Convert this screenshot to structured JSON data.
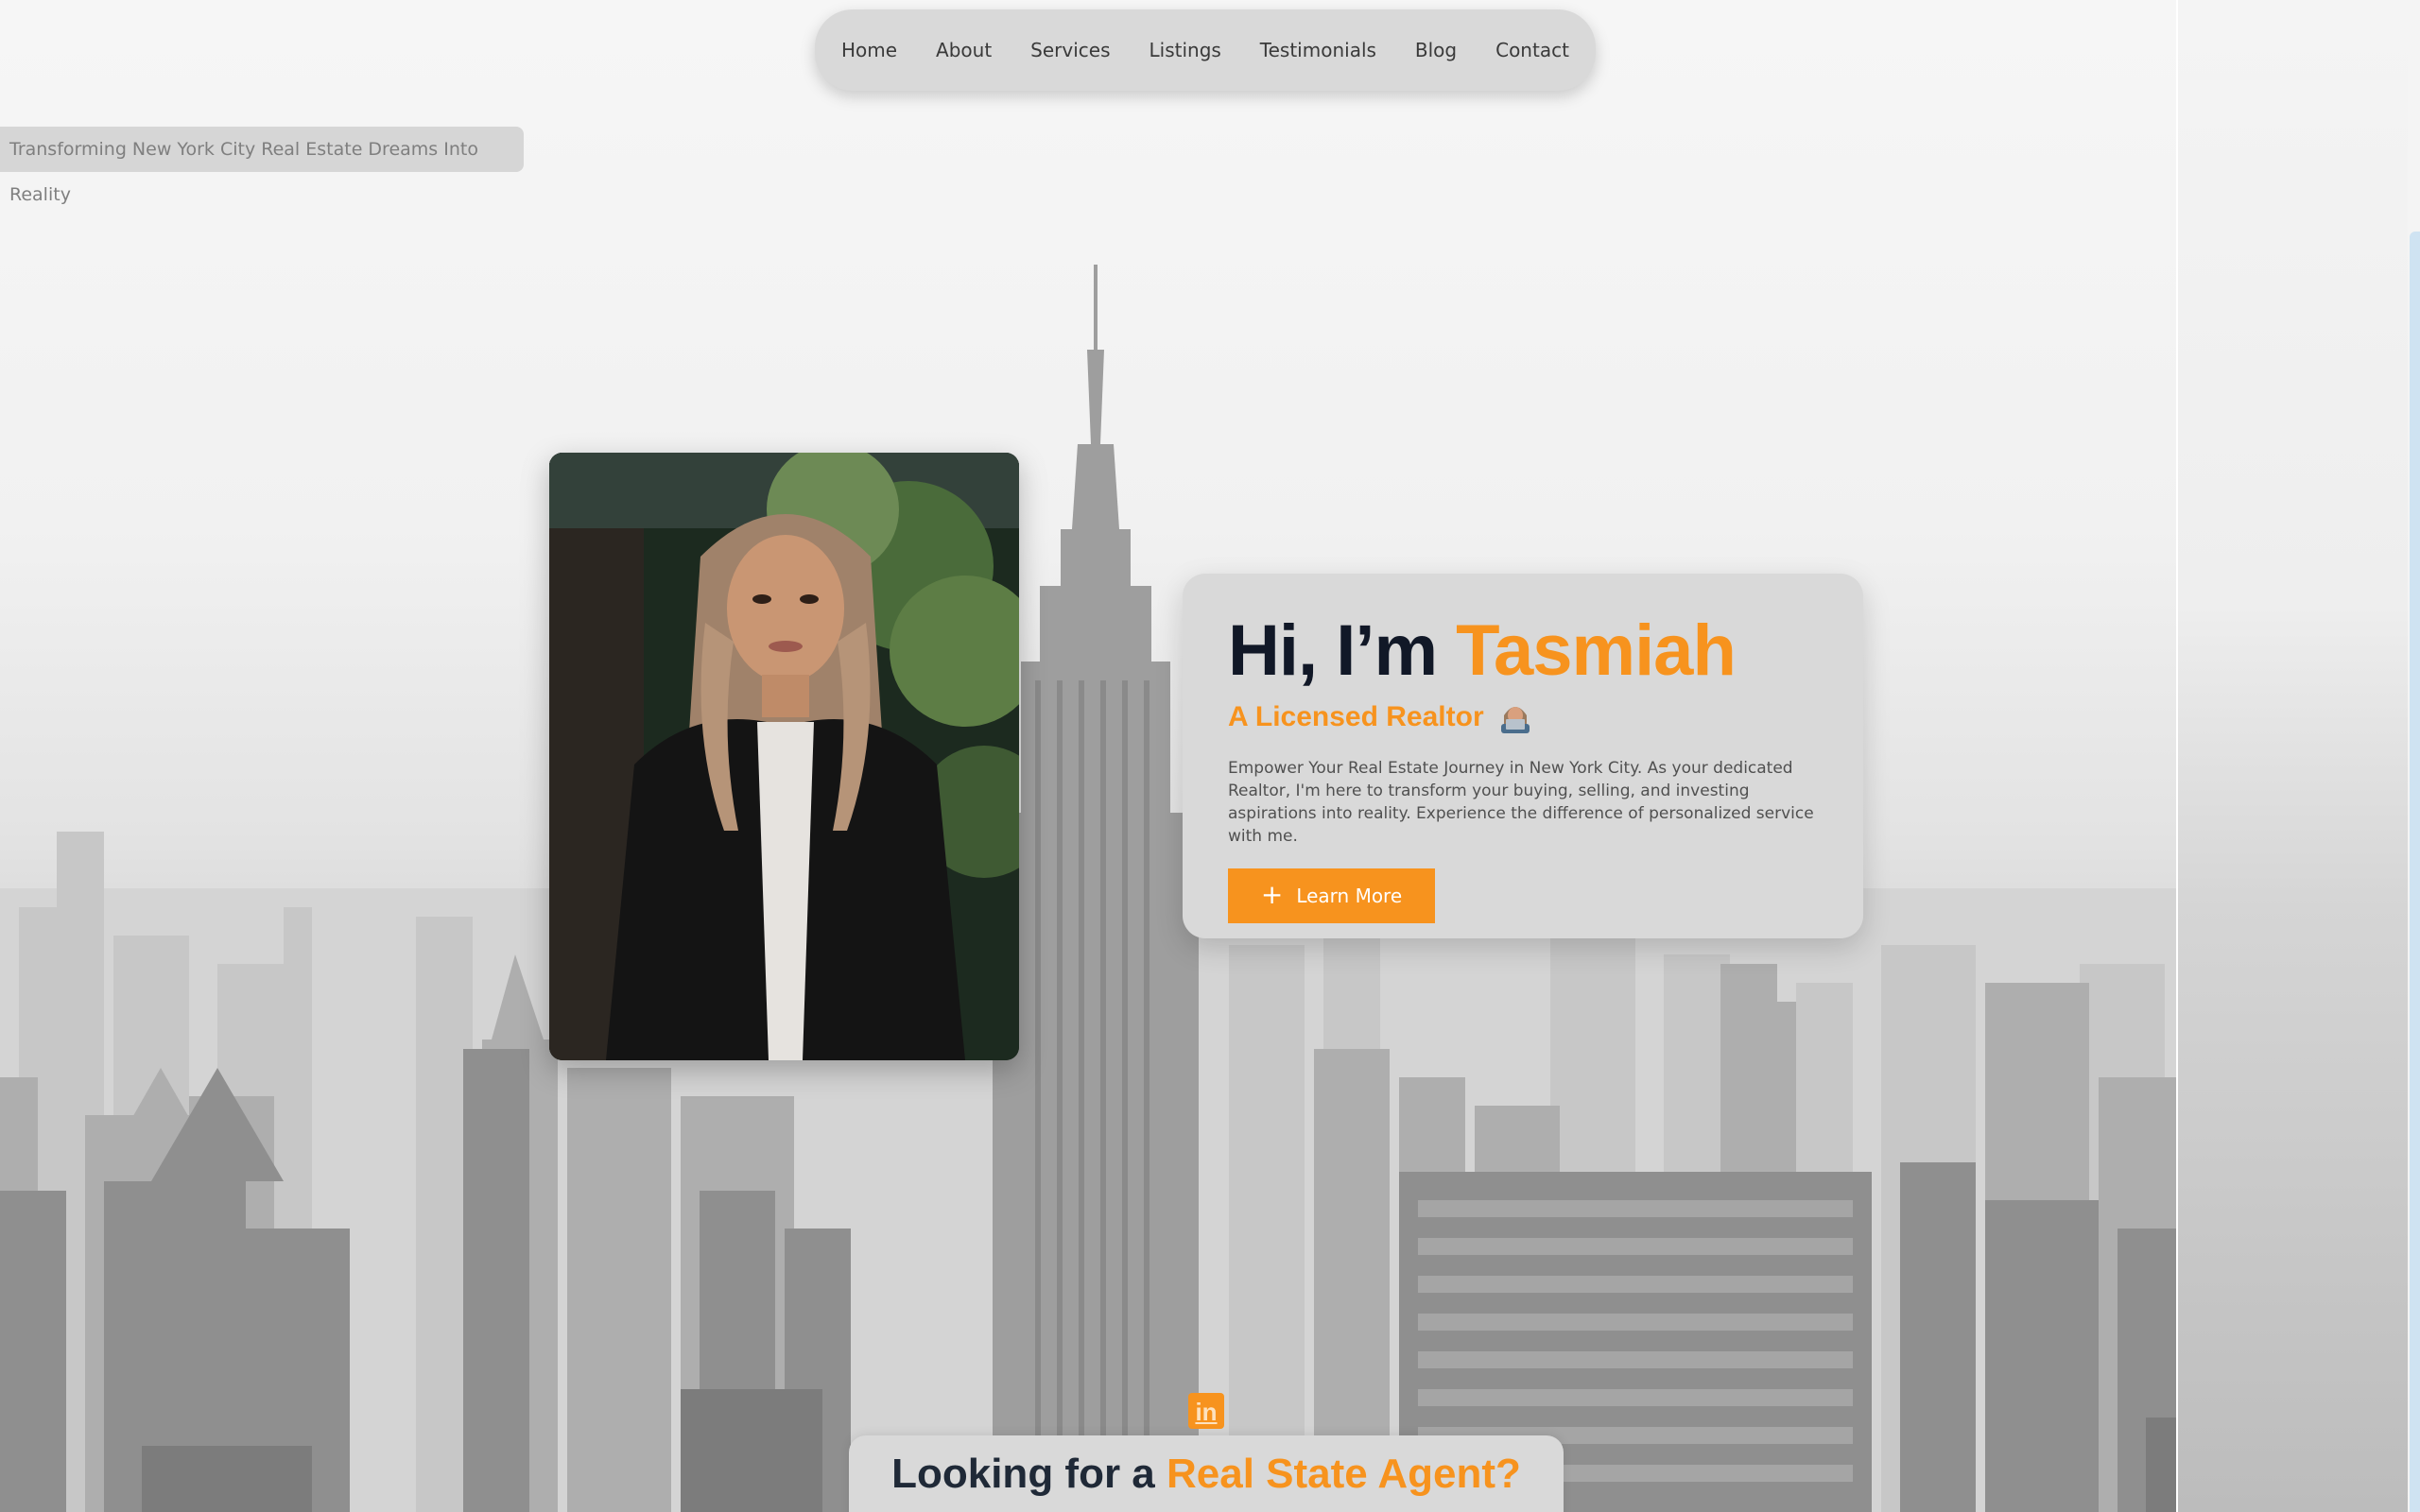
{
  "nav": {
    "items": [
      "Home",
      "About",
      "Services",
      "Listings",
      "Testimonials",
      "Blog",
      "Contact"
    ]
  },
  "tagline": "Transforming New York City Real Estate Dreams Into Reality",
  "hero": {
    "title_prefix": "Hi, I’m",
    "title_name": "Tasmiah",
    "subtitle": "A Licensed Realtor",
    "subtitle_icon": "woman-technologist-emoji-icon",
    "description": "Empower Your Real Estate Journey in New York City. As your dedicated Realtor, I'm here to transform your buying, selling, and investing aspirations into reality. Experience the difference of personalized service with me.",
    "button_label": "Learn More",
    "button_icon": "plus-icon"
  },
  "social": {
    "linkedin_label": "in"
  },
  "section": {
    "title_prefix": "Looking for a",
    "title_accent": "Real State Agent?"
  },
  "colors": {
    "accent": "#f7931e",
    "title": "#111827",
    "card": "#d9d9d9"
  }
}
